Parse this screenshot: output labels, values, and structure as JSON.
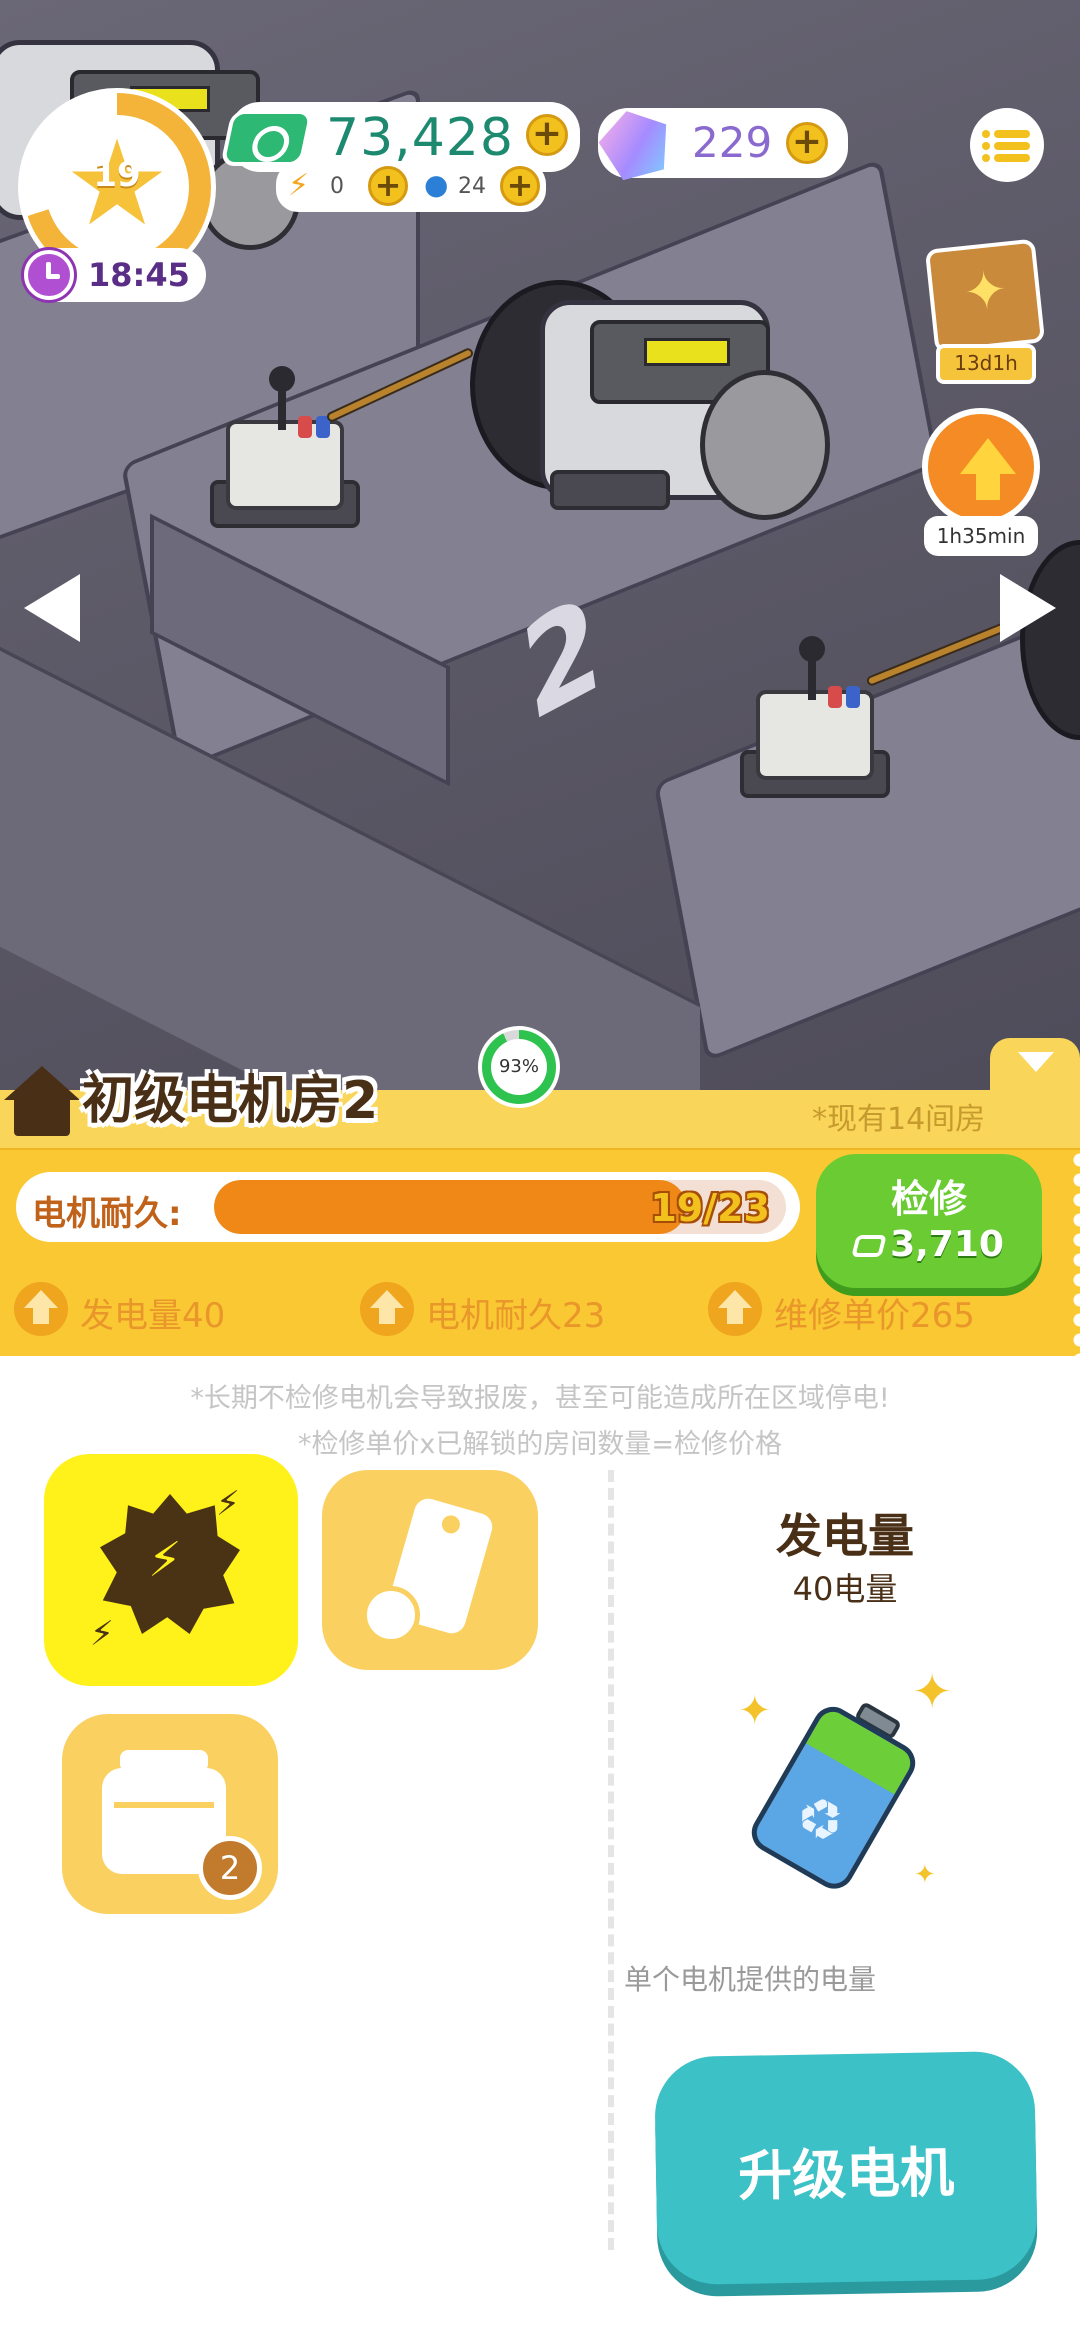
{
  "hud": {
    "level": "19",
    "timer": "18:45",
    "money": "73,428",
    "energy": "0",
    "water": "24",
    "gems": "229",
    "event_timer": "13d1h",
    "boost_timer": "1h35min"
  },
  "scene": {
    "floor_number": "2"
  },
  "room": {
    "title": "初级电机房2",
    "completion": "93%",
    "completion_value": 0.93,
    "rooms_owned": "*现有14间房",
    "durability_label": "电机耐久:",
    "durability_value": "19/23",
    "durability_fraction": 0.826,
    "repair_label": "检修",
    "repair_cost": "3,710",
    "stats": [
      {
        "label": "发电量40"
      },
      {
        "label": "电机耐久23"
      },
      {
        "label": "维修单价265"
      }
    ]
  },
  "notes": {
    "warning": "*长期不检修电机会导致报废，甚至可能造成所在区域停电!",
    "formula": "*检修单价x已解锁的房间数量=检修价格"
  },
  "upgrades": {
    "kit_badge": "2",
    "detail_title": "发电量",
    "detail_value": "40电量",
    "detail_desc": "单个电机提供的电量",
    "upgrade_button": "升级电机"
  },
  "colors": {
    "panel_yellow": "#f9c833",
    "repair_green": "#6acb33",
    "upgrade_teal": "#3cc1c6",
    "durability_orange": "#ef8817"
  }
}
